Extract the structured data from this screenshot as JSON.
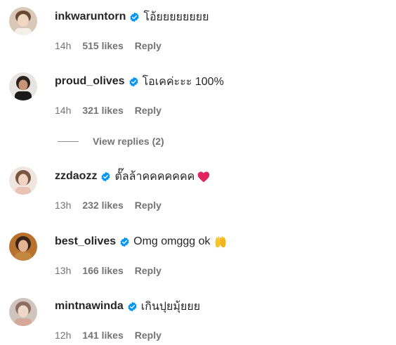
{
  "comments": [
    {
      "username": "inkwaruntorn",
      "text": "โอ้ยยยยยยยย",
      "time": "14h",
      "likes": "515 likes",
      "reply": "Reply",
      "verified": true,
      "emoji": ""
    },
    {
      "username": "proud_olives",
      "text": "โอเคค่ะะะ 100%",
      "time": "14h",
      "likes": "321 likes",
      "reply": "Reply",
      "verified": true,
      "emoji": ""
    },
    {
      "username": "zzdaozz",
      "text": "ตั๊ลล้าคคคคคคค",
      "time": "13h",
      "likes": "232 likes",
      "reply": "Reply",
      "verified": true,
      "emoji": "red-heart-icon"
    },
    {
      "username": "best_olives",
      "text": "Omg omggg ok",
      "time": "13h",
      "likes": "166 likes",
      "reply": "Reply",
      "verified": true,
      "emoji": "raising-hands-icon"
    },
    {
      "username": "mintnawinda",
      "text": "เกินปุยมุ้ยยย",
      "time": "12h",
      "likes": "141 likes",
      "reply": "Reply",
      "verified": true,
      "emoji": ""
    }
  ],
  "view_replies": {
    "label": "View replies (2)"
  },
  "colors": {
    "verified_badge": "#0095f6",
    "meta_text": "#737373",
    "primary_text": "#262626",
    "heart": "#e0245e"
  }
}
